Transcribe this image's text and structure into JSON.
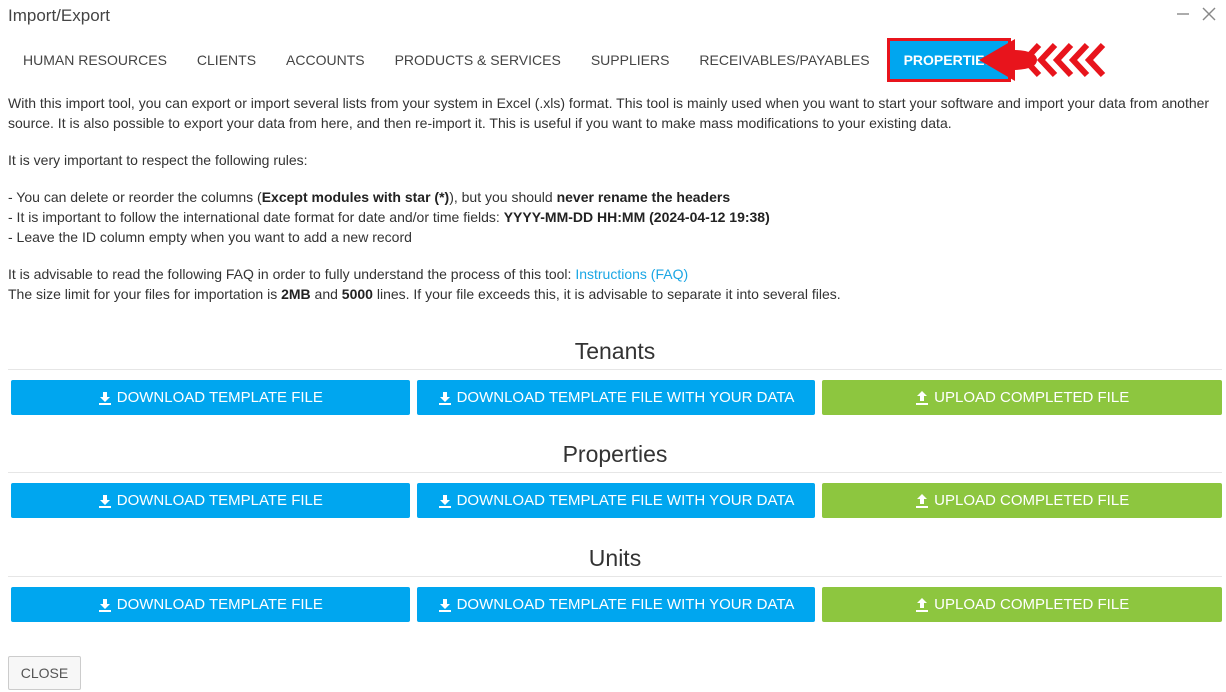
{
  "window": {
    "title": "Import/Export",
    "minimize_icon": "minimize-icon",
    "close_icon": "close-icon"
  },
  "tabs": [
    {
      "label": "HUMAN RESOURCES",
      "active": false
    },
    {
      "label": "CLIENTS",
      "active": false
    },
    {
      "label": "ACCOUNTS",
      "active": false
    },
    {
      "label": "PRODUCTS & SERVICES",
      "active": false
    },
    {
      "label": "SUPPLIERS",
      "active": false
    },
    {
      "label": "RECEIVABLES/PAYABLES",
      "active": false
    },
    {
      "label": "PROPERTIES",
      "active": true
    }
  ],
  "intro": {
    "p1": "With this import tool, you can export or import several lists from your system in Excel (.xls) format. This tool is mainly used when you want to start your software and import your data from another source. It is also possible to export your data from here, and then re-import it. This is useful if you want to make mass modifications to your existing data.",
    "p2": "It is very important to respect the following rules:",
    "rule1_a": "- You can delete or reorder the columns (",
    "rule1_b": "Except modules with star (*)",
    "rule1_c": "), but you should ",
    "rule1_d": "never rename the headers",
    "rule2_a": "- It is important to follow the international date format for date and/or time fields: ",
    "rule2_b": "YYYY-MM-DD HH:MM (2024-04-12 19:38)",
    "rule3": "- Leave the ID column empty when you want to add a new record",
    "faq_a": "It is advisable to read the following FAQ in order to fully understand the process of this tool: ",
    "faq_link": "Instructions (FAQ)",
    "size_a": "The size limit for your files for importation is ",
    "size_b": "2MB",
    "size_c": " and ",
    "size_d": "5000",
    "size_e": " lines. If your file exceeds this, it is advisable to separate it into several files."
  },
  "sections": [
    {
      "title": "Tenants",
      "download_label": "DOWNLOAD TEMPLATE FILE",
      "download_data_label": "DOWNLOAD TEMPLATE FILE WITH YOUR DATA",
      "upload_label": "UPLOAD COMPLETED FILE"
    },
    {
      "title": "Properties",
      "download_label": "DOWNLOAD TEMPLATE FILE",
      "download_data_label": "DOWNLOAD TEMPLATE FILE WITH YOUR DATA",
      "upload_label": "UPLOAD COMPLETED FILE"
    },
    {
      "title": "Units",
      "download_label": "DOWNLOAD TEMPLATE FILE",
      "download_data_label": "DOWNLOAD TEMPLATE FILE WITH YOUR DATA",
      "upload_label": "UPLOAD COMPLETED FILE"
    }
  ],
  "footer": {
    "close_label": "CLOSE"
  },
  "colors": {
    "accent_blue": "#00a6ef",
    "upload_green": "#8dc63f",
    "highlight_red": "#e8141c",
    "link": "#1aa6e4"
  }
}
